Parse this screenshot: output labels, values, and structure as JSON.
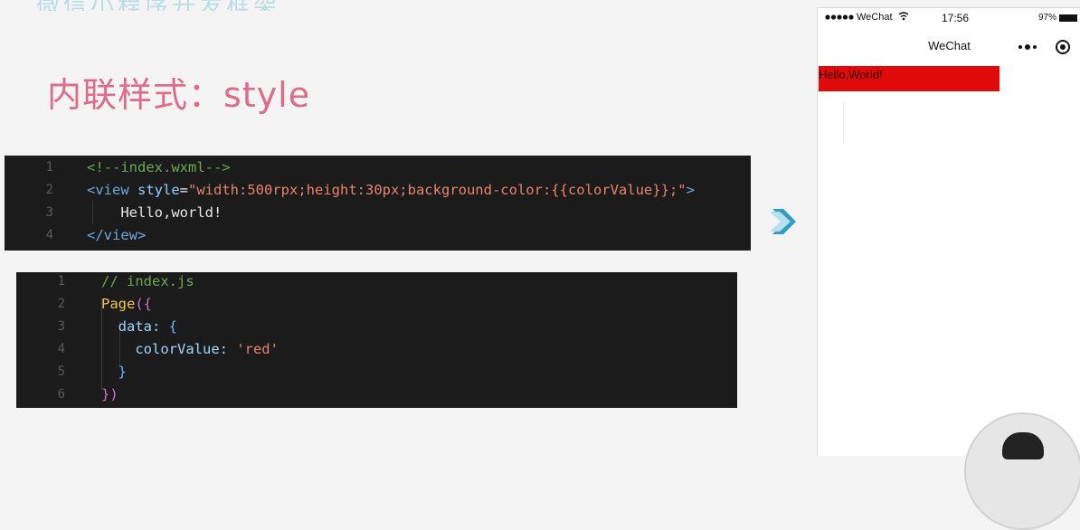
{
  "slide": {
    "top_text": "微信小程序开发框架",
    "title": "内联样式：style"
  },
  "wxml_code": {
    "lines": [
      {
        "num": "1",
        "segments": [
          {
            "t": "<!--index.wxml-->",
            "c": "c-comment"
          }
        ]
      },
      {
        "num": "2",
        "segments": [
          {
            "t": "<",
            "c": "c-tag"
          },
          {
            "t": "view",
            "c": "c-tag"
          },
          {
            "t": " style",
            "c": "c-attr"
          },
          {
            "t": "=",
            "c": "c-text"
          },
          {
            "t": "\"width:500rpx;height:30px;background-color:{{colorValue}};\"",
            "c": "c-str"
          },
          {
            "t": ">",
            "c": "c-tag"
          }
        ]
      },
      {
        "num": "3",
        "segments": [
          {
            "t": "    Hello,world!",
            "c": "c-text"
          }
        ]
      },
      {
        "num": "4",
        "segments": [
          {
            "t": "</",
            "c": "c-tag"
          },
          {
            "t": "view",
            "c": "c-tag"
          },
          {
            "t": ">",
            "c": "c-tag"
          }
        ]
      }
    ]
  },
  "js_code": {
    "lines": [
      {
        "num": "1",
        "segments": [
          {
            "t": "// index.js",
            "c": "c-comment"
          }
        ]
      },
      {
        "num": "2",
        "segments": [
          {
            "t": "Page",
            "c": "c-fn"
          },
          {
            "t": "({",
            "c": "c-brace"
          }
        ]
      },
      {
        "num": "3",
        "segments": [
          {
            "t": "  data: ",
            "c": "c-prop"
          },
          {
            "t": "{",
            "c": "c-blue"
          }
        ]
      },
      {
        "num": "4",
        "segments": [
          {
            "t": "    colorValue: ",
            "c": "c-prop"
          },
          {
            "t": "'red'",
            "c": "c-str"
          }
        ]
      },
      {
        "num": "5",
        "segments": [
          {
            "t": "  }",
            "c": "c-blue"
          }
        ]
      },
      {
        "num": "6",
        "segments": [
          {
            "t": "})",
            "c": "c-brace"
          }
        ]
      }
    ]
  },
  "phone": {
    "carrier": "WeChat",
    "time": "17:56",
    "battery": "97%",
    "nav_title": "WeChat",
    "view_text": "Hello,World!",
    "view_color": "#e00a0a"
  },
  "icons": {
    "arrow": "chevron-right-icon",
    "more": "more-dots-icon",
    "record": "record-icon",
    "wifi": "wifi-icon",
    "battery": "battery-icon",
    "signal": "signal-dots-icon"
  }
}
